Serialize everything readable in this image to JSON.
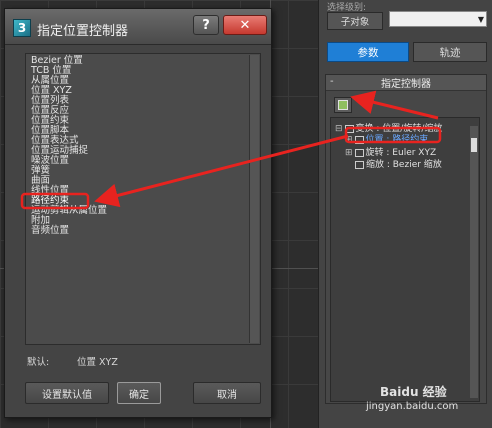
{
  "dialog": {
    "title": "指定位置控制器",
    "help_label": "?",
    "close_label": "✕",
    "items": [
      "Bezier 位置",
      "TCB 位置",
      "从属位置",
      "位置 XYZ",
      "位置列表",
      "位置反应",
      "位置约束",
      "位置脚本",
      "位置表达式",
      "位置运动捕捉",
      "噪波位置",
      "弹簧",
      "曲面",
      "线性位置",
      "路径约束",
      "运动剪辑从属位置",
      "附加",
      "音频位置"
    ],
    "selected_index": 14,
    "default_label": "默认:",
    "default_value": "位置 XYZ",
    "buttons": {
      "set_default": "设置默认值",
      "ok": "确定",
      "cancel": "取消"
    }
  },
  "panel": {
    "top_text": "选择级别:",
    "subobject_button": "子对象",
    "tabs": {
      "params": "参数",
      "track": "轨迹"
    },
    "rollout_title": "指定控制器",
    "rollout_toggle": "-",
    "tree": [
      {
        "mark": "⊟",
        "text": "变换 : 位置/旋转/缩放",
        "highlight": false
      },
      {
        "mark": "⊞",
        "text": "位置 : 路径约束",
        "highlight": true
      },
      {
        "mark": "⊞",
        "text": "旋转 : Euler XYZ",
        "highlight": false
      },
      {
        "mark": "",
        "text": "缩放 : Bezier 缩放",
        "highlight": false
      }
    ]
  },
  "watermark": {
    "line1": "Baidu 经验",
    "line2": "jingyan.baidu.com"
  },
  "colors": {
    "annotation_red": "#e8231f",
    "tab_active": "#1f7fd6"
  }
}
